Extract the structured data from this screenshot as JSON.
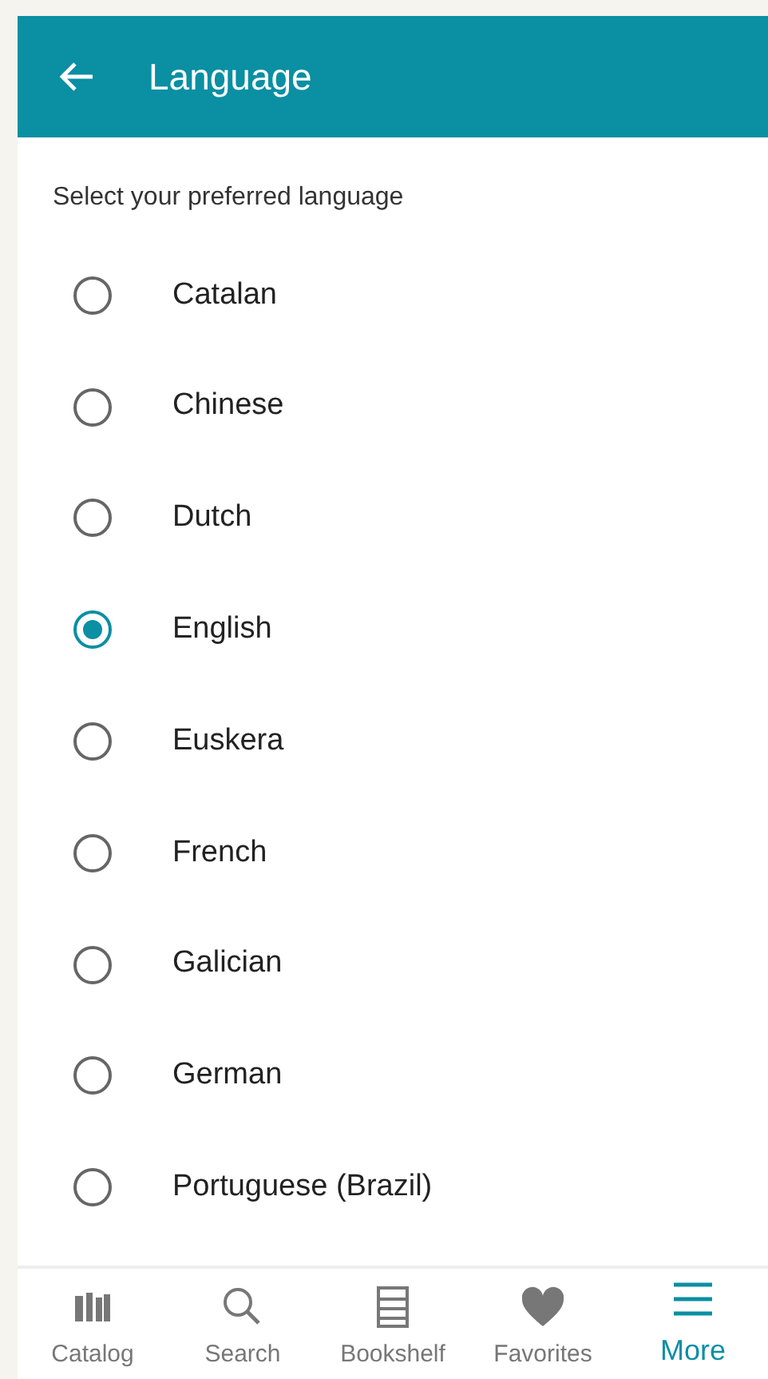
{
  "app_bar": {
    "title": "Language"
  },
  "prompt": "Select your preferred language",
  "languages": [
    {
      "label": "Catalan",
      "selected": false
    },
    {
      "label": "Chinese",
      "selected": false
    },
    {
      "label": "Dutch",
      "selected": false
    },
    {
      "label": "English",
      "selected": true
    },
    {
      "label": "Euskera",
      "selected": false
    },
    {
      "label": "French",
      "selected": false
    },
    {
      "label": "Galician",
      "selected": false
    },
    {
      "label": "German",
      "selected": false
    },
    {
      "label": "Portuguese (Brazil)",
      "selected": false
    }
  ],
  "bottom_nav": [
    {
      "kind": "catalog",
      "label": "Catalog",
      "selected": false
    },
    {
      "kind": "search",
      "label": "Search",
      "selected": false
    },
    {
      "kind": "bookshelf",
      "label": "Bookshelf",
      "selected": false
    },
    {
      "kind": "favorites",
      "label": "Favorites",
      "selected": false
    },
    {
      "kind": "more",
      "label": "More",
      "selected": true
    }
  ]
}
